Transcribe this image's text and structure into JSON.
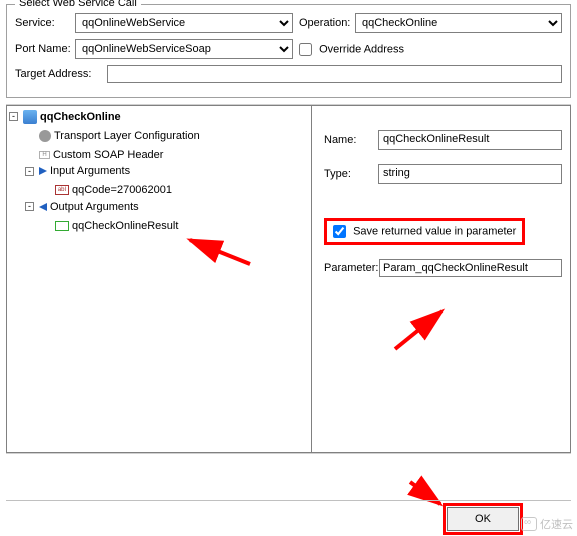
{
  "fieldset_title": "Select Web Service Call",
  "labels": {
    "service": "Service:",
    "operation": "Operation:",
    "port_name": "Port Name:",
    "override": "Override Address",
    "target_address": "Target Address:",
    "name": "Name:",
    "type": "Type:",
    "save_returned": "Save returned value in parameter",
    "parameter": "Parameter:",
    "ok": "OK"
  },
  "values": {
    "service": "qqOnlineWebService",
    "operation": "qqCheckOnline",
    "port_name": "qqOnlineWebServiceSoap",
    "override_checked": false,
    "target_address": "",
    "detail_name": "qqCheckOnlineResult",
    "detail_type": "string",
    "save_checked": true,
    "parameter": "Param_qqCheckOnlineResult"
  },
  "tree": {
    "root": "qqCheckOnline",
    "tlc": "Transport Layer Configuration",
    "soap": "Custom SOAP Header",
    "input": "Input Arguments",
    "qqcode": "qqCode=270062001",
    "output": "Output Arguments",
    "result": "qqCheckOnlineResult"
  },
  "watermark": "亿速云"
}
